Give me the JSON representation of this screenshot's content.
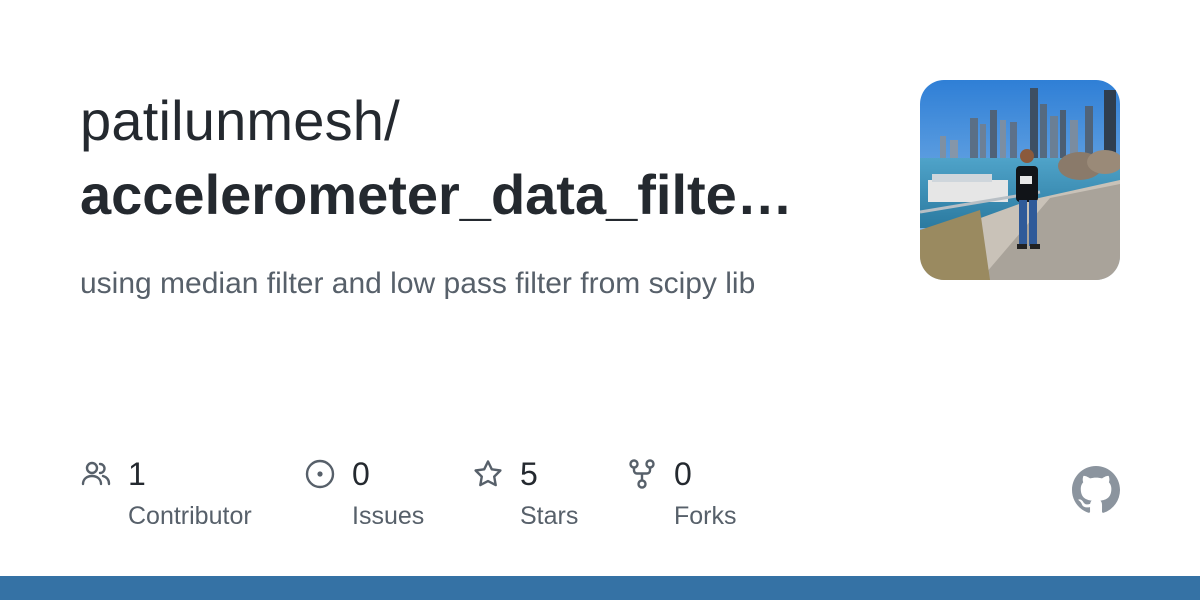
{
  "repository": {
    "owner": "patilunmesh/",
    "name": "accelerometer_data_filte…",
    "description": "using median filter and low pass filter from scipy lib"
  },
  "stats": [
    {
      "icon": "people-icon",
      "value": "1",
      "label": "Contributor"
    },
    {
      "icon": "issue-opened-icon",
      "value": "0",
      "label": "Issues"
    },
    {
      "icon": "star-icon",
      "value": "5",
      "label": "Stars"
    },
    {
      "icon": "repo-forked-icon",
      "value": "0",
      "label": "Forks"
    }
  ],
  "branding": {
    "logo": "github-mark-icon",
    "bar_color": "#3572a5",
    "text_color": "#24292f",
    "muted_color": "#57606a"
  }
}
